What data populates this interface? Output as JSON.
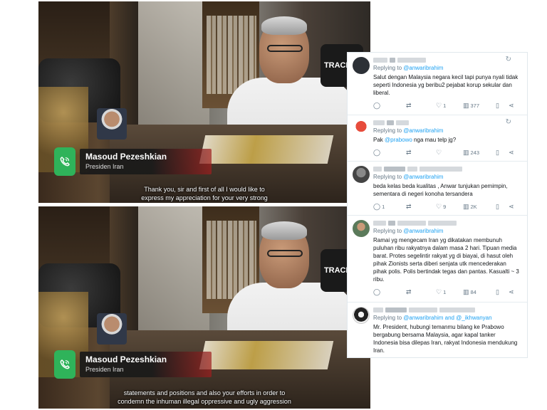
{
  "video_frames": [
    {
      "caller_name": "Masoud Pezeshkian",
      "caller_title": "Presiden Iran",
      "subtitle_line1": "Thank you, sir and first of all I would like to",
      "subtitle_line2": "express my appreciation for your very strong",
      "studio_logo": "TRACING"
    },
    {
      "caller_name": "Masoud Pezeshkian",
      "caller_title": "Presiden Iran",
      "subtitle_line1": "statements and positions and also your efforts in order to",
      "subtitle_line2": "condemn the inhuman illegal oppressive and ugly aggression",
      "studio_logo": "TRACING"
    }
  ],
  "replies": [
    {
      "replying_prefix": "Replying to ",
      "replying_to": "@anwaribrahim",
      "text": "Salut dengan Malaysia negara kecil tapi punya nyali tidak seperti Indonesia yg beribu2 pejabat korup sekular dan liberal.",
      "reply_count": "",
      "retweet_count": "",
      "like_count": "1",
      "view_count": "377",
      "avatar_color": "#2c3036"
    },
    {
      "replying_prefix": "Replying to ",
      "replying_to": "@anwaribrahim",
      "text_prefix": "Pak ",
      "text_mention": "@prabowo",
      "text_suffix": " nga mau telp jg?",
      "reply_count": "",
      "retweet_count": "",
      "like_count": "",
      "view_count": "243",
      "avatar_color": "#c0392b"
    },
    {
      "replying_prefix": "Replying to ",
      "replying_to": "@anwaribrahim",
      "text": "beda kelas beda kualitas , Anwar tunjukan pemimpin, sementara di negeri konoha tersandera",
      "reply_count": "1",
      "retweet_count": "",
      "like_count": "9",
      "view_count": "2K",
      "avatar_color": "#6d6d6d"
    },
    {
      "replying_prefix": "Replying to ",
      "replying_to": "@anwaribrahim",
      "text": "Ramai yg mengecam Iran yg dikatakan membunuh puluhan ribu rakyatnya dalam masa 2 hari. Tipuan media barat. Protes segelintir rakyat yg di biayai, di hasut oleh pihak Zionists serta diberi senjata utk mencederakan pihak polis. Polis bertindak tegas dan pantas. Kasualti ~ 3 ribu.",
      "reply_count": "",
      "retweet_count": "",
      "like_count": "1",
      "view_count": "84",
      "avatar_color": "#5b7a5a"
    },
    {
      "replying_prefix": "Replying to ",
      "replying_to": "@anwaribrahim and @_ikhwanyan",
      "text": "Mr. President, hubungi temanmu bilang ke Prabowo bergabung bersama Malaysia, agar kapal tanker Indonesia bisa dilepas Iran, rakyat Indonesia mendukung Iran.",
      "avatar_color": "#8a8f96"
    }
  ],
  "icons": {
    "call": "phone-icon",
    "reply": "reply-icon",
    "retweet": "retweet-icon",
    "like": "heart-icon",
    "views": "views-icon",
    "bookmark": "bookmark-icon",
    "share": "share-icon",
    "grok": "grok-icon"
  },
  "colors": {
    "call_green": "#2fb35a",
    "mention_blue": "#1da1f2",
    "muted_text": "#657786"
  }
}
